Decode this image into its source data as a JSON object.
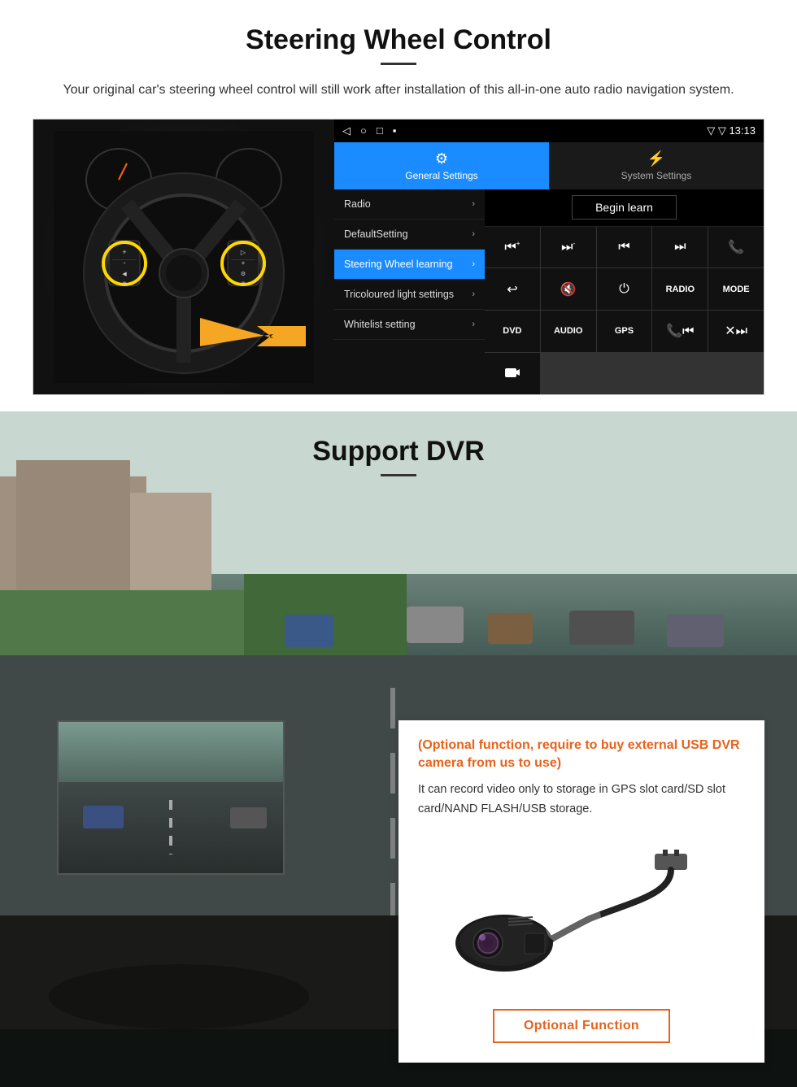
{
  "page": {
    "sections": {
      "steering": {
        "title": "Steering Wheel Control",
        "description": "Your original car's steering wheel control will still work after installation of this all-in-one auto radio navigation system.",
        "ui": {
          "statusbar": {
            "nav_back": "◁",
            "nav_home": "○",
            "nav_square": "□",
            "nav_menu": "▪",
            "signal": "▼",
            "wifi": "▼",
            "time": "13:13"
          },
          "tabs": {
            "general": {
              "label": "General Settings",
              "icon": "⚙"
            },
            "system": {
              "label": "System Settings",
              "icon": "⚡"
            }
          },
          "menu_items": [
            {
              "label": "Radio",
              "active": false
            },
            {
              "label": "DefaultSetting",
              "active": false
            },
            {
              "label": "Steering Wheel learning",
              "active": true
            },
            {
              "label": "Tricoloured light settings",
              "active": false
            },
            {
              "label": "Whitelist setting",
              "active": false
            }
          ],
          "begin_learn_label": "Begin learn",
          "ctrl_buttons": [
            {
              "icon": "⏮+",
              "label": "vol+prev"
            },
            {
              "icon": "⏭-",
              "label": "vol-next"
            },
            {
              "icon": "⏮",
              "label": "prev"
            },
            {
              "icon": "⏭",
              "label": "next"
            },
            {
              "icon": "📞",
              "label": "call"
            },
            {
              "icon": "↩",
              "label": "back"
            },
            {
              "icon": "🔇",
              "label": "mute"
            },
            {
              "icon": "⏻",
              "label": "power"
            },
            {
              "icon": "RADIO",
              "label": "radio"
            },
            {
              "icon": "MODE",
              "label": "mode"
            },
            {
              "icon": "DVD",
              "label": "dvd"
            },
            {
              "icon": "AUDIO",
              "label": "audio"
            },
            {
              "icon": "GPS",
              "label": "gps"
            },
            {
              "icon": "📞⏮",
              "label": "tel-prev"
            },
            {
              "icon": "✕⏭",
              "label": "end-next"
            },
            {
              "icon": "📷",
              "label": "camera"
            }
          ]
        }
      },
      "dvr": {
        "title": "Support DVR",
        "optional_text": "(Optional function, require to buy external USB DVR camera from us to use)",
        "description": "It can record video only to storage in GPS slot card/SD slot card/NAND FLASH/USB storage.",
        "optional_function_label": "Optional Function"
      }
    }
  }
}
